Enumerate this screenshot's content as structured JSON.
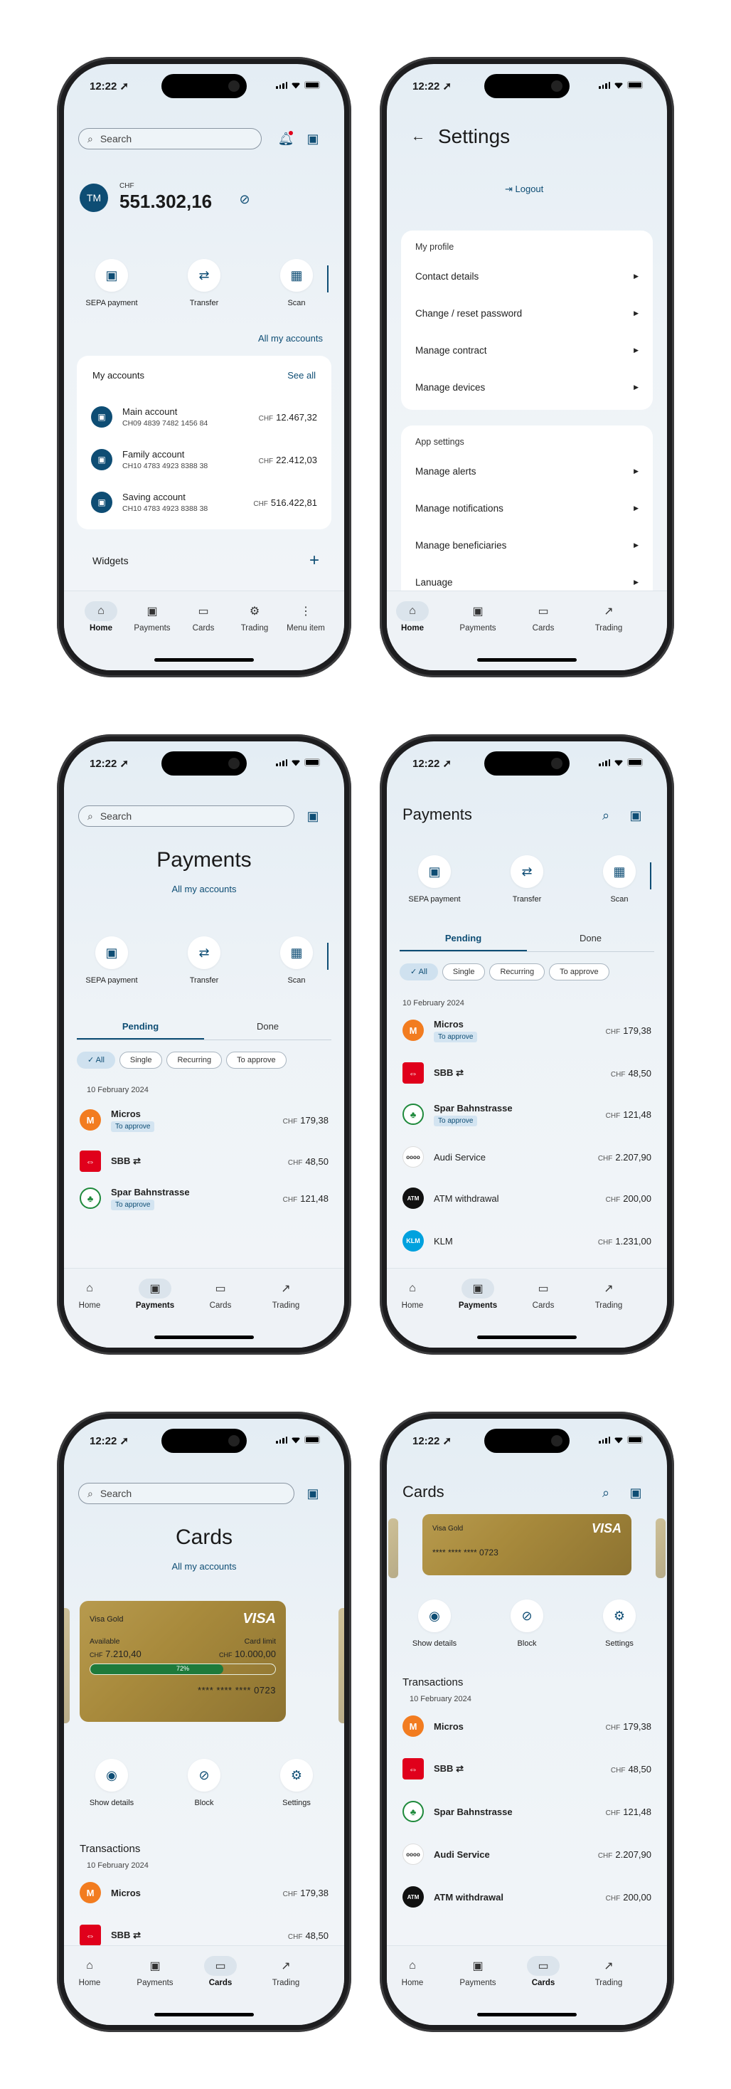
{
  "status": {
    "time": "12:22 ➚"
  },
  "nav_labels": {
    "home": "Home",
    "payments": "Payments",
    "cards": "Cards",
    "trading": "Trading",
    "menu": "Menu item"
  },
  "home": {
    "search_placeholder": "Search",
    "avatar_initials": "TM",
    "balance_currency": "CHF",
    "balance": "551.302,16",
    "quick_actions": [
      {
        "label": "SEPA payment",
        "icon": "sepa-icon"
      },
      {
        "label": "Transfer",
        "icon": "transfer-icon"
      },
      {
        "label": "Scan",
        "icon": "qr-icon"
      }
    ],
    "all_accounts_link": "All my accounts",
    "accounts_title": "My accounts",
    "see_all": "See all",
    "accounts": [
      {
        "name": "Main account",
        "iban": "CH09 4839 7482 1456 84",
        "currency": "CHF",
        "amount": "12.467,32"
      },
      {
        "name": "Family account",
        "iban": "CH10 4783 4923 8388 38",
        "currency": "CHF",
        "amount": "22.412,03"
      },
      {
        "name": "Saving account",
        "iban": "CH10 4783 4923 8388 38",
        "currency": "CHF",
        "amount": "516.422,81"
      }
    ],
    "widgets_title": "Widgets"
  },
  "settings": {
    "title": "Settings",
    "logout": "Logout",
    "profile_title": "My profile",
    "profile_items": [
      "Contact details",
      "Change / reset password",
      "Manage contract",
      "Manage devices"
    ],
    "app_title": "App settings",
    "app_items": [
      "Manage alerts",
      "Manage notifications",
      "Manage beneficiaries",
      "Lanuage"
    ]
  },
  "payments": {
    "title": "Payments",
    "all_accounts": "All my accounts",
    "tabs": [
      "Pending",
      "Done"
    ],
    "chips": [
      "All",
      "Single",
      "Recurring",
      "To approve"
    ],
    "date": "10 February 2024",
    "transactions": [
      {
        "name": "Micros",
        "badge": "To approve",
        "currency": "CHF",
        "amount": "179,38",
        "logo": "M",
        "color": "#f27c20"
      },
      {
        "name": "SBB",
        "badge": "",
        "currency": "CHF",
        "amount": "48,50",
        "logo": "⇔",
        "color": "#e0001b"
      },
      {
        "name": "Spar Bahnstrasse",
        "badge": "To approve",
        "currency": "CHF",
        "amount": "121,48",
        "logo": "♣",
        "color": "#1f8a3c"
      },
      {
        "name": "Audi Service",
        "badge": "",
        "currency": "CHF",
        "amount": "2.207,90",
        "logo": "oooo",
        "color": "#ffffff"
      },
      {
        "name": "ATM withdrawal",
        "badge": "",
        "currency": "CHF",
        "amount": "200,00",
        "logo": "ATM",
        "color": "#111111"
      },
      {
        "name": "KLM",
        "badge": "",
        "currency": "CHF",
        "amount": "1.231,00",
        "logo": "KLM",
        "color": "#00a1de"
      }
    ]
  },
  "cards": {
    "title": "Cards",
    "all_accounts": "All my accounts",
    "card_name": "Visa Gold",
    "brand": "VISA",
    "available_label": "Available",
    "limit_label": "Card limit",
    "available_currency": "CHF",
    "available": "7.210,40",
    "limit_currency": "CHF",
    "limit": "10.000,00",
    "usage_percent": 72,
    "usage_label": "72%",
    "card_number": "**** **** **** 0723",
    "actions": [
      {
        "label": "Show details",
        "icon": "eye-icon"
      },
      {
        "label": "Block",
        "icon": "block-icon"
      },
      {
        "label": "Settings",
        "icon": "gear-icon"
      }
    ],
    "transactions_title": "Transactions",
    "date": "10 February 2024"
  }
}
